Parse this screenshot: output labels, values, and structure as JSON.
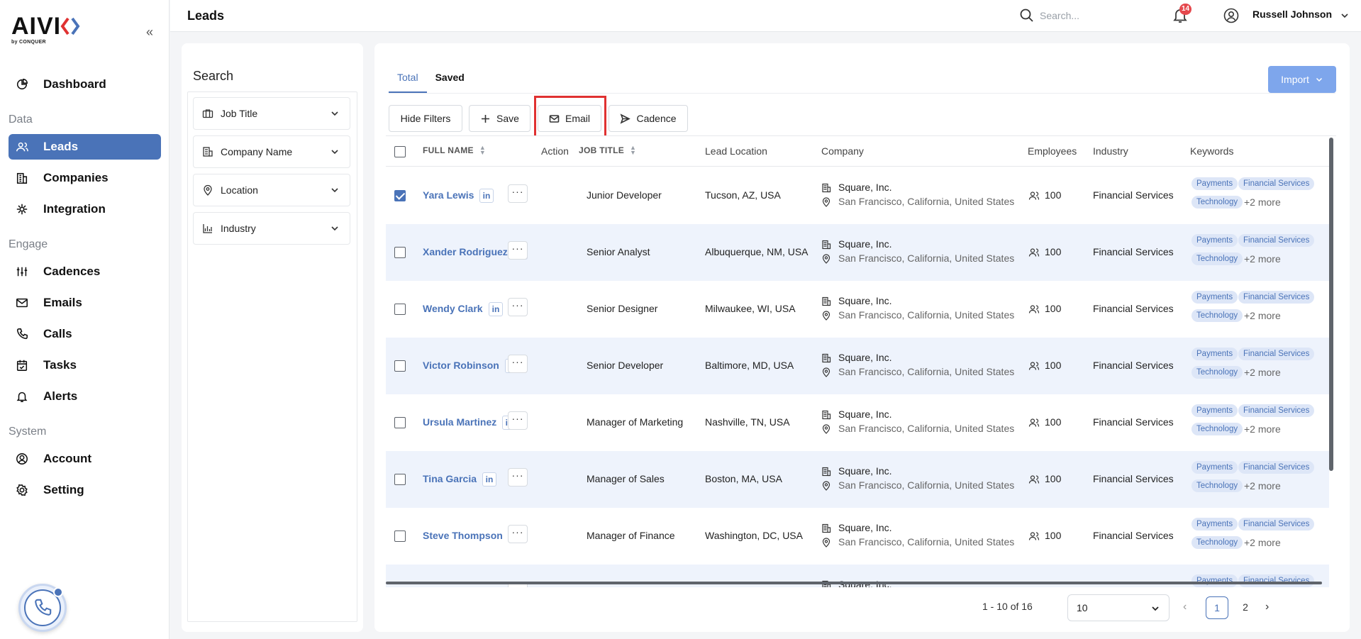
{
  "app": {
    "brand": "AIVI",
    "tagline": "by CONQUER",
    "colors": {
      "accent": "#4a73b8",
      "import_button": "#7ea6ec",
      "highlight": "#e03131",
      "badge": "#e5484d"
    }
  },
  "sidebar": {
    "sections": {
      "data": "Data",
      "engage": "Engage",
      "system": "System"
    },
    "items": [
      {
        "label": "Dashboard",
        "icon": "dashboard-icon",
        "active": false
      },
      {
        "label": "Leads",
        "icon": "users-icon",
        "active": true
      },
      {
        "label": "Companies",
        "icon": "building-icon",
        "active": false
      },
      {
        "label": "Integration",
        "icon": "integration-icon",
        "active": false
      },
      {
        "label": "Cadences",
        "icon": "sliders-icon",
        "active": false
      },
      {
        "label": "Emails",
        "icon": "mail-icon",
        "active": false
      },
      {
        "label": "Calls",
        "icon": "phone-icon",
        "active": false
      },
      {
        "label": "Tasks",
        "icon": "calendar-check-icon",
        "active": false
      },
      {
        "label": "Alerts",
        "icon": "bell-icon",
        "active": false
      },
      {
        "label": "Account",
        "icon": "user-circle-icon",
        "active": false
      },
      {
        "label": "Setting",
        "icon": "gear-icon",
        "active": false
      }
    ]
  },
  "header": {
    "title": "Leads",
    "search_placeholder": "Search...",
    "notification_count": "14",
    "user_name": "Russell Johnson"
  },
  "filters": {
    "title": "Search",
    "items": [
      {
        "label": "Job Title",
        "icon": "briefcase-icon"
      },
      {
        "label": "Company Name",
        "icon": "building-icon"
      },
      {
        "label": "Location",
        "icon": "map-pin-icon"
      },
      {
        "label": "Industry",
        "icon": "chart-icon"
      }
    ]
  },
  "main": {
    "tabs": [
      {
        "label": "Total",
        "active": true
      },
      {
        "label": "Saved",
        "active": false
      }
    ],
    "import_label": "Import",
    "toolbar": {
      "hide_filters": "Hide Filters",
      "save": "Save",
      "email": "Email",
      "cadence": "Cadence"
    },
    "table": {
      "headers": {
        "full_name": "FULL NAME",
        "action": "Action",
        "job_title": "JOB TITLE",
        "lead_location": "Lead Location",
        "company": "Company",
        "employees": "Employees",
        "industry": "Industry",
        "keywords": "Keywords"
      },
      "linkedin_label": "in",
      "action_label": "···",
      "rows": [
        {
          "name": "Yara Lewis",
          "checked": true,
          "job": "Junior Developer",
          "location": "Tucson, AZ, USA",
          "company": "Square, Inc.",
          "company_location": "San Francisco, California, United States",
          "employees": "100",
          "industry": "Financial Services",
          "tags": [
            "Payments",
            "Financial Services",
            "Technology"
          ],
          "more": "+2 more"
        },
        {
          "name": "Xander Rodriguez",
          "checked": false,
          "job": "Senior Analyst",
          "location": "Albuquerque, NM, USA",
          "company": "Square, Inc.",
          "company_location": "San Francisco, California, United States",
          "employees": "100",
          "industry": "Financial Services",
          "tags": [
            "Payments",
            "Financial Services",
            "Technology"
          ],
          "more": "+2 more"
        },
        {
          "name": "Wendy Clark",
          "checked": false,
          "job": "Senior Designer",
          "location": "Milwaukee, WI, USA",
          "company": "Square, Inc.",
          "company_location": "San Francisco, California, United States",
          "employees": "100",
          "industry": "Financial Services",
          "tags": [
            "Payments",
            "Financial Services",
            "Technology"
          ],
          "more": "+2 more"
        },
        {
          "name": "Victor Robinson",
          "checked": false,
          "job": "Senior Developer",
          "location": "Baltimore, MD, USA",
          "company": "Square, Inc.",
          "company_location": "San Francisco, California, United States",
          "employees": "100",
          "industry": "Financial Services",
          "tags": [
            "Payments",
            "Financial Services",
            "Technology"
          ],
          "more": "+2 more"
        },
        {
          "name": "Ursula Martinez",
          "checked": false,
          "job": "Manager of Marketing",
          "location": "Nashville, TN, USA",
          "company": "Square, Inc.",
          "company_location": "San Francisco, California, United States",
          "employees": "100",
          "industry": "Financial Services",
          "tags": [
            "Payments",
            "Financial Services",
            "Technology"
          ],
          "more": "+2 more"
        },
        {
          "name": "Tina Garcia",
          "checked": false,
          "job": "Manager of Sales",
          "location": "Boston, MA, USA",
          "company": "Square, Inc.",
          "company_location": "San Francisco, California, United States",
          "employees": "100",
          "industry": "Financial Services",
          "tags": [
            "Payments",
            "Financial Services",
            "Technology"
          ],
          "more": "+2 more"
        },
        {
          "name": "Steve Thompson",
          "checked": false,
          "job": "Manager of Finance",
          "location": "Washington, DC, USA",
          "company": "Square, Inc.",
          "company_location": "San Francisco, California, United States",
          "employees": "100",
          "industry": "Financial Services",
          "tags": [
            "Payments",
            "Financial Services",
            "Technology"
          ],
          "more": "+2 more"
        },
        {
          "name": "",
          "checked": false,
          "job": "",
          "location": "",
          "company": "Square, Inc.",
          "company_location": "",
          "employees": "",
          "industry": "",
          "tags": [
            "Payments",
            "Financial Services"
          ],
          "more": ""
        }
      ]
    },
    "pagination": {
      "range": "1 - 10 of 16",
      "page_size": "10",
      "pages": [
        "1",
        "2"
      ],
      "current": "1"
    }
  }
}
